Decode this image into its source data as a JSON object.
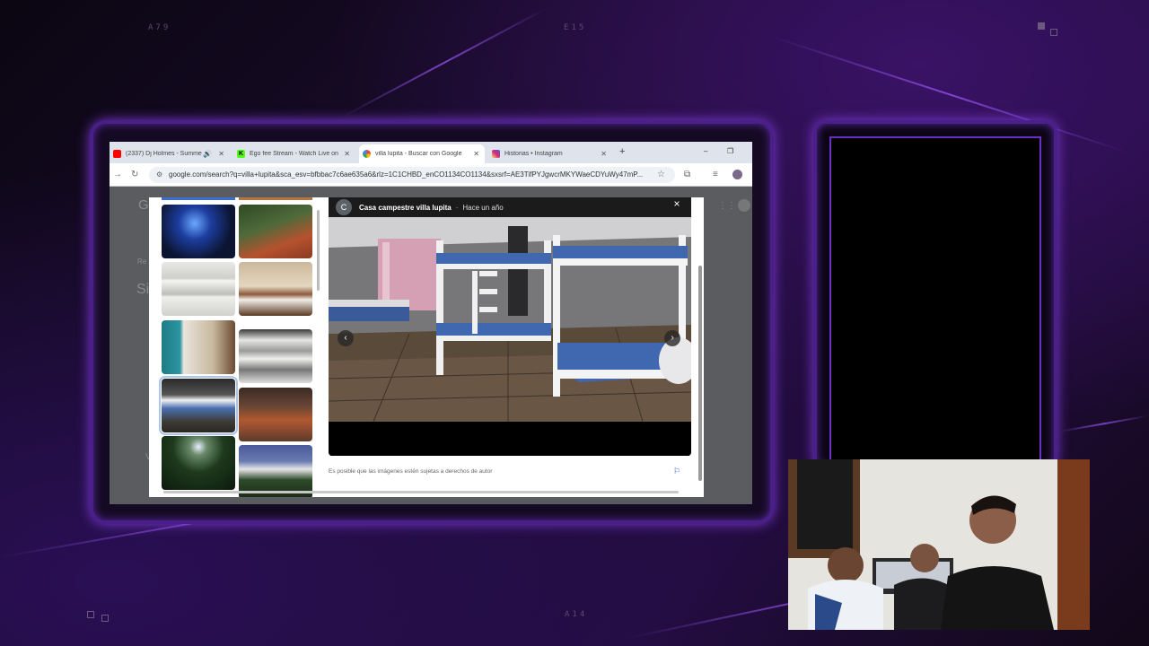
{
  "background": {
    "codes": [
      "A79",
      "E15",
      "A14"
    ],
    "accent_color": "#7a3ad0"
  },
  "browser": {
    "tabs": [
      {
        "title": "(2337) Dj Holmes - Summe",
        "icon": "youtube-icon",
        "color": "#ff0000",
        "active": false
      },
      {
        "title": "Ego fee Stream - Watch Live on",
        "icon": "kick-icon",
        "color": "#53fc18",
        "active": false
      },
      {
        "title": "villa lupita - Buscar con Google",
        "icon": "google-icon",
        "color": "#4285f4",
        "active": true
      },
      {
        "title": "Historias • Instagram",
        "icon": "instagram-icon",
        "color": "#d62976",
        "active": false
      }
    ],
    "new_tab": "+",
    "window_controls": {
      "minimize": "–",
      "restore": "❐"
    },
    "url": "google.com/search?q=villa+lupita&sca_esv=bfbbac7c6ae635a6&rlz=1C1CHBD_enCO1134CO1134&sxsrf=AE3TifPYJgwcrMKYWaeCDYuWy47mP..."
  },
  "lightbox": {
    "source_initial": "C",
    "source_name": "Casa campestre villa lupita",
    "separator": "·",
    "time_ago": "Hace un año",
    "close": "×",
    "prev": "‹",
    "next": "›",
    "copyright_notice": "Es posible que las imágenes estén sujetas a derechos de autor",
    "flag": "⚐"
  },
  "page_fragments": [
    "G",
    "Re",
    "Si",
    "V"
  ]
}
